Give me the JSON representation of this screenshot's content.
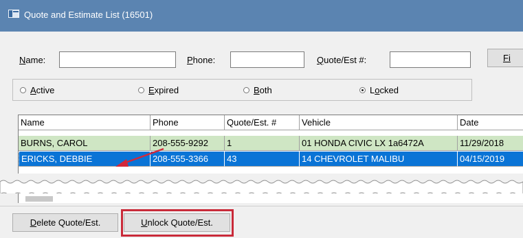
{
  "window": {
    "title": "Quote and Estimate List (16501)"
  },
  "search": {
    "name_label_u": "N",
    "name_label_rest": "ame:",
    "name_value": "",
    "phone_label_u": "P",
    "phone_label_rest": "hone:",
    "phone_value": "",
    "quote_label_u": "Q",
    "quote_label_rest": "uote/Est #:",
    "quote_value": "",
    "find_label": "Fi"
  },
  "filters": [
    {
      "u": "A",
      "rest": "ctive",
      "selected": false
    },
    {
      "u": "E",
      "rest": "xpired",
      "selected": false
    },
    {
      "u": "B",
      "rest": "oth",
      "selected": false
    },
    {
      "u": "o",
      "pre": "L",
      "rest": "cked",
      "selected": true
    }
  ],
  "table": {
    "columns": [
      "Name",
      "Phone",
      "Quote/Est. #",
      "Vehicle",
      "Date"
    ],
    "rows": [
      [
        "BURNS, CAROL",
        "208-555-9292",
        "1",
        "01 HONDA CIVIC LX 1a6472A",
        "11/29/2018"
      ],
      [
        "ERICKS, DEBBIE",
        "208-555-3366",
        "43",
        "14 CHEVROLET MALIBU",
        "04/15/2019"
      ]
    ],
    "selected_row": 1
  },
  "buttons": {
    "delete_u": "D",
    "delete_rest": "elete Quote/Est.",
    "unlock_u": "U",
    "unlock_rest": "nlock Quote/Est."
  },
  "colors": {
    "titlebar": "#5b84b1",
    "selected_row": "#0a74d6",
    "locked_row": "#cfe6c4",
    "highlight": "#c92a39",
    "arrow": "#d3283a"
  }
}
